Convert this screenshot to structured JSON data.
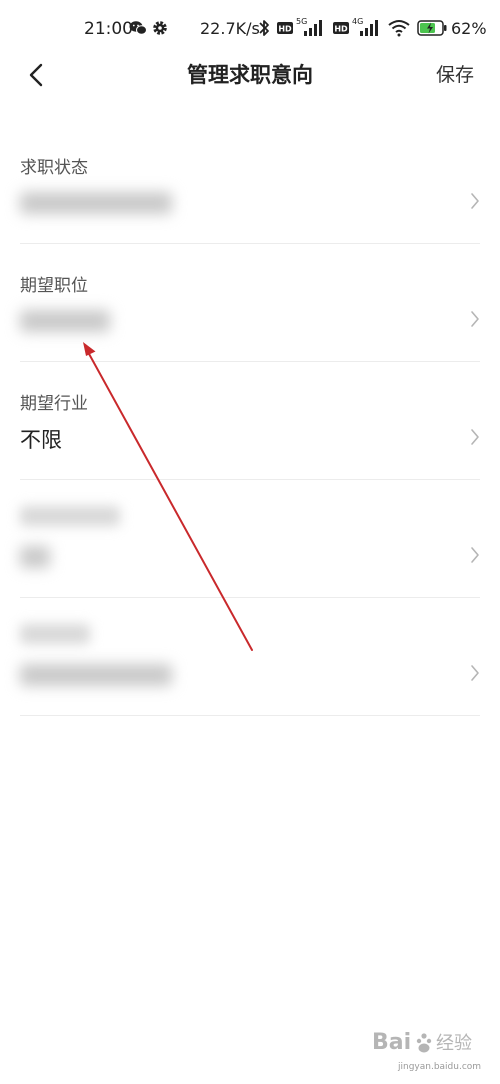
{
  "status_bar": {
    "time": "21:00",
    "net_speed": "22.7K/s",
    "battery_pct": "62%",
    "icons": [
      "wechat-icon",
      "gear-icon",
      "bluetooth-icon",
      "hd-icon",
      "signal-5g-icon",
      "hd-icon",
      "signal-4g-icon",
      "wifi-icon",
      "battery-charging-icon"
    ],
    "signal_1_label": "5G",
    "signal_2_label": "4G",
    "hd_label": "HD"
  },
  "header": {
    "back_icon": "chevron-left-icon",
    "title": "管理求职意向",
    "save_label": "保存"
  },
  "items": [
    {
      "label": "求职状态",
      "value": "",
      "value_redacted": true
    },
    {
      "label": "期望职位",
      "value": "",
      "value_redacted": true
    },
    {
      "label": "期望行业",
      "value": "不限",
      "value_redacted": false
    },
    {
      "label": "",
      "label_redacted": true,
      "value": "",
      "value_redacted": true
    },
    {
      "label": "",
      "label_redacted": true,
      "value": "",
      "value_redacted": true
    }
  ],
  "annotation": {
    "color": "#c9292c"
  },
  "watermark": {
    "text": "Bai 经验",
    "subtext": "jingyan.baidu.com"
  },
  "colors": {
    "divider": "#ececec",
    "text_primary": "#222222",
    "text_label": "#555555",
    "chevron": "#b5b5b5"
  }
}
